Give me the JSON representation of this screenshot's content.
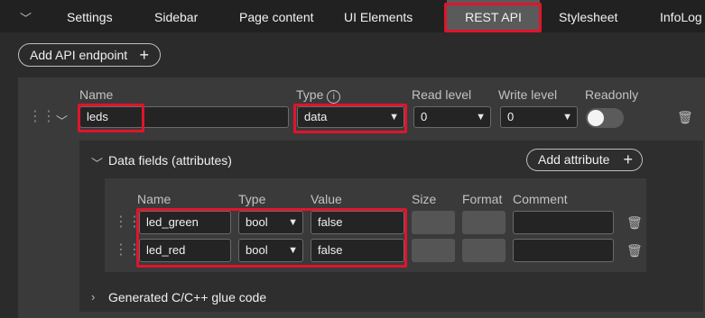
{
  "tabs": [
    {
      "label": "Settings"
    },
    {
      "label": "Sidebar"
    },
    {
      "label": "Page content"
    },
    {
      "label": "UI Elements"
    },
    {
      "label": "REST API"
    },
    {
      "label": "Stylesheet"
    },
    {
      "label": "InfoLog"
    }
  ],
  "active_tab": "REST API",
  "add_endpoint_label": "Add API endpoint",
  "endpoint": {
    "headers": {
      "name": "Name",
      "type": "Type",
      "read_level": "Read level",
      "write_level": "Write level",
      "readonly": "Readonly"
    },
    "name_value": "leds",
    "type_value": "data",
    "read_level_value": "0",
    "write_level_value": "0",
    "readonly": false
  },
  "data_fields": {
    "title": "Data fields (attributes)",
    "add_attribute_label": "Add attribute",
    "columns": {
      "name": "Name",
      "type": "Type",
      "value": "Value",
      "size": "Size",
      "format": "Format",
      "comment": "Comment"
    },
    "rows": [
      {
        "name": "led_green",
        "type": "bool",
        "value": "false"
      },
      {
        "name": "led_red",
        "type": "bool",
        "value": "false"
      }
    ]
  },
  "glue_code_title": "Generated C/C++ glue code",
  "colors": {
    "highlight": "#e0142b",
    "active_tab": "#5a5a5a"
  }
}
